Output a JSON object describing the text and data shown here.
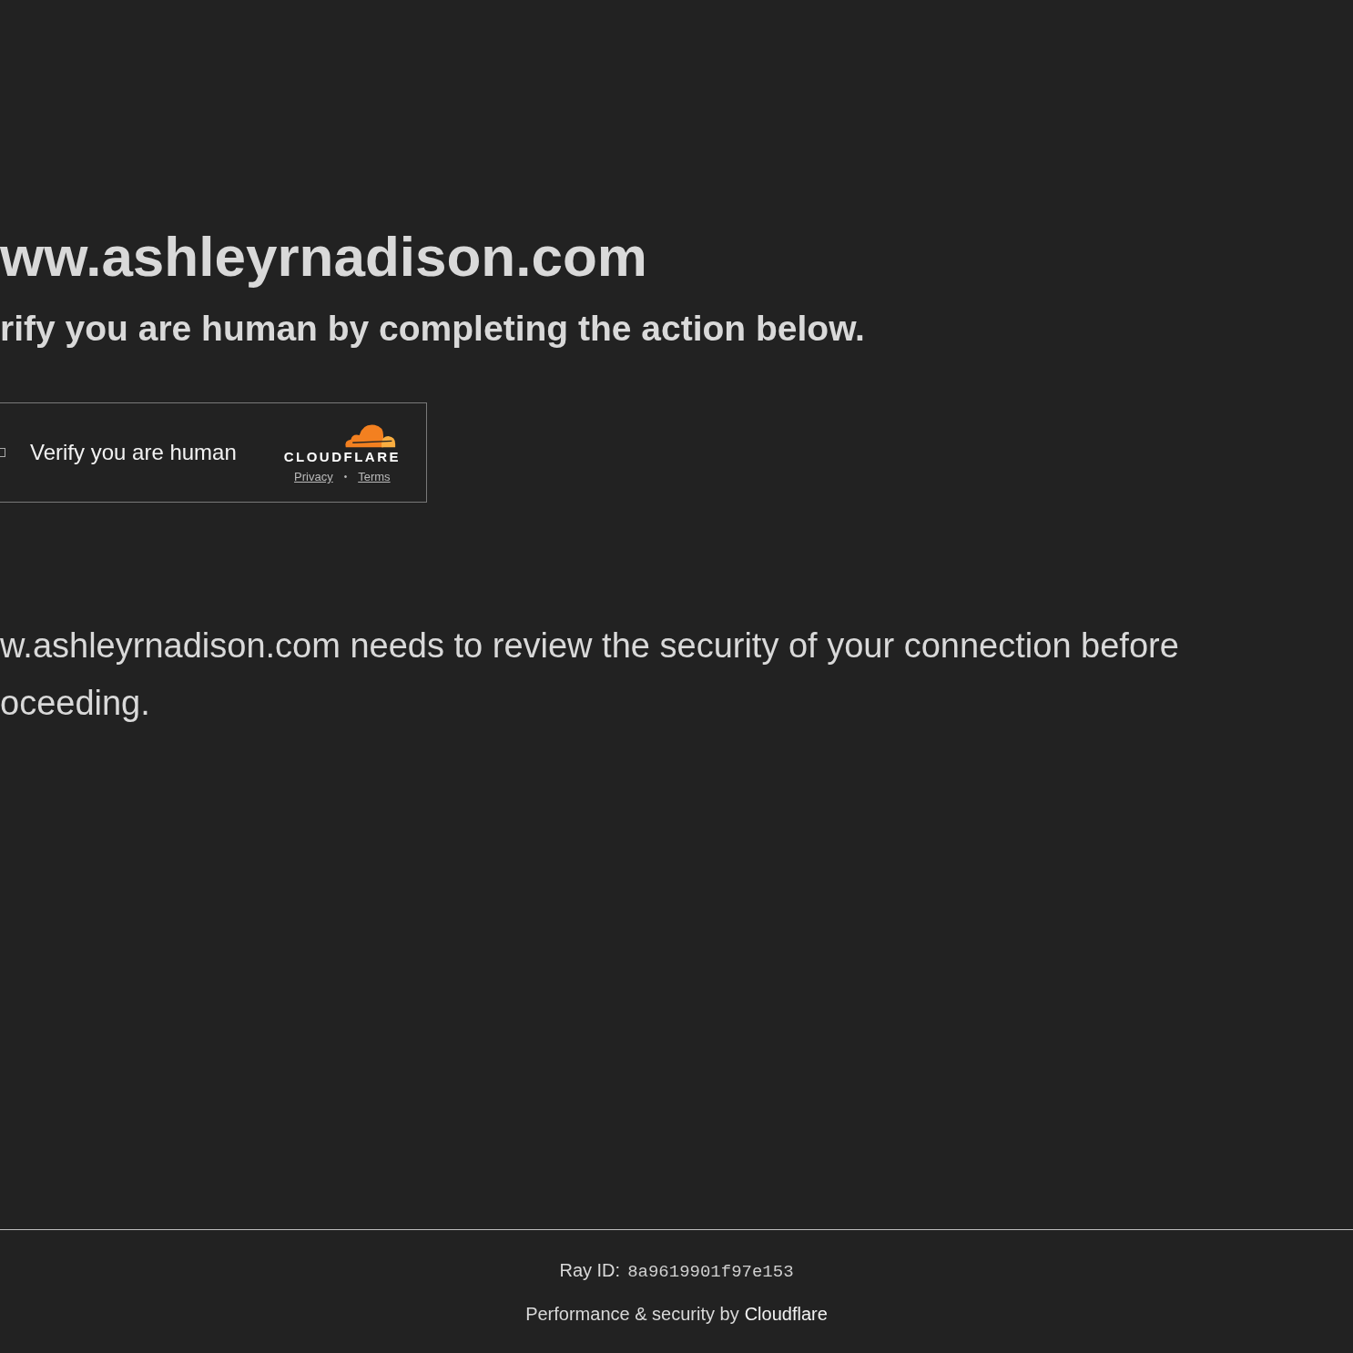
{
  "heading": "ww.ashleyrnadison.com",
  "subheading": "rify you are human by completing the action below.",
  "widget": {
    "checkbox": {
      "checked": false
    },
    "label": "Verify you are human",
    "brand": "CLOUDFLARE",
    "links": [
      "Privacy",
      "Terms"
    ],
    "separator": "•"
  },
  "message": "w.ashleyrnadison.com needs to review the security of your connection before oceeding.",
  "footer": {
    "ray_label": "Ray ID:",
    "ray_id": "8a9619901f97e153",
    "credit": "Performance & security by",
    "credit_link": "Cloudflare"
  }
}
